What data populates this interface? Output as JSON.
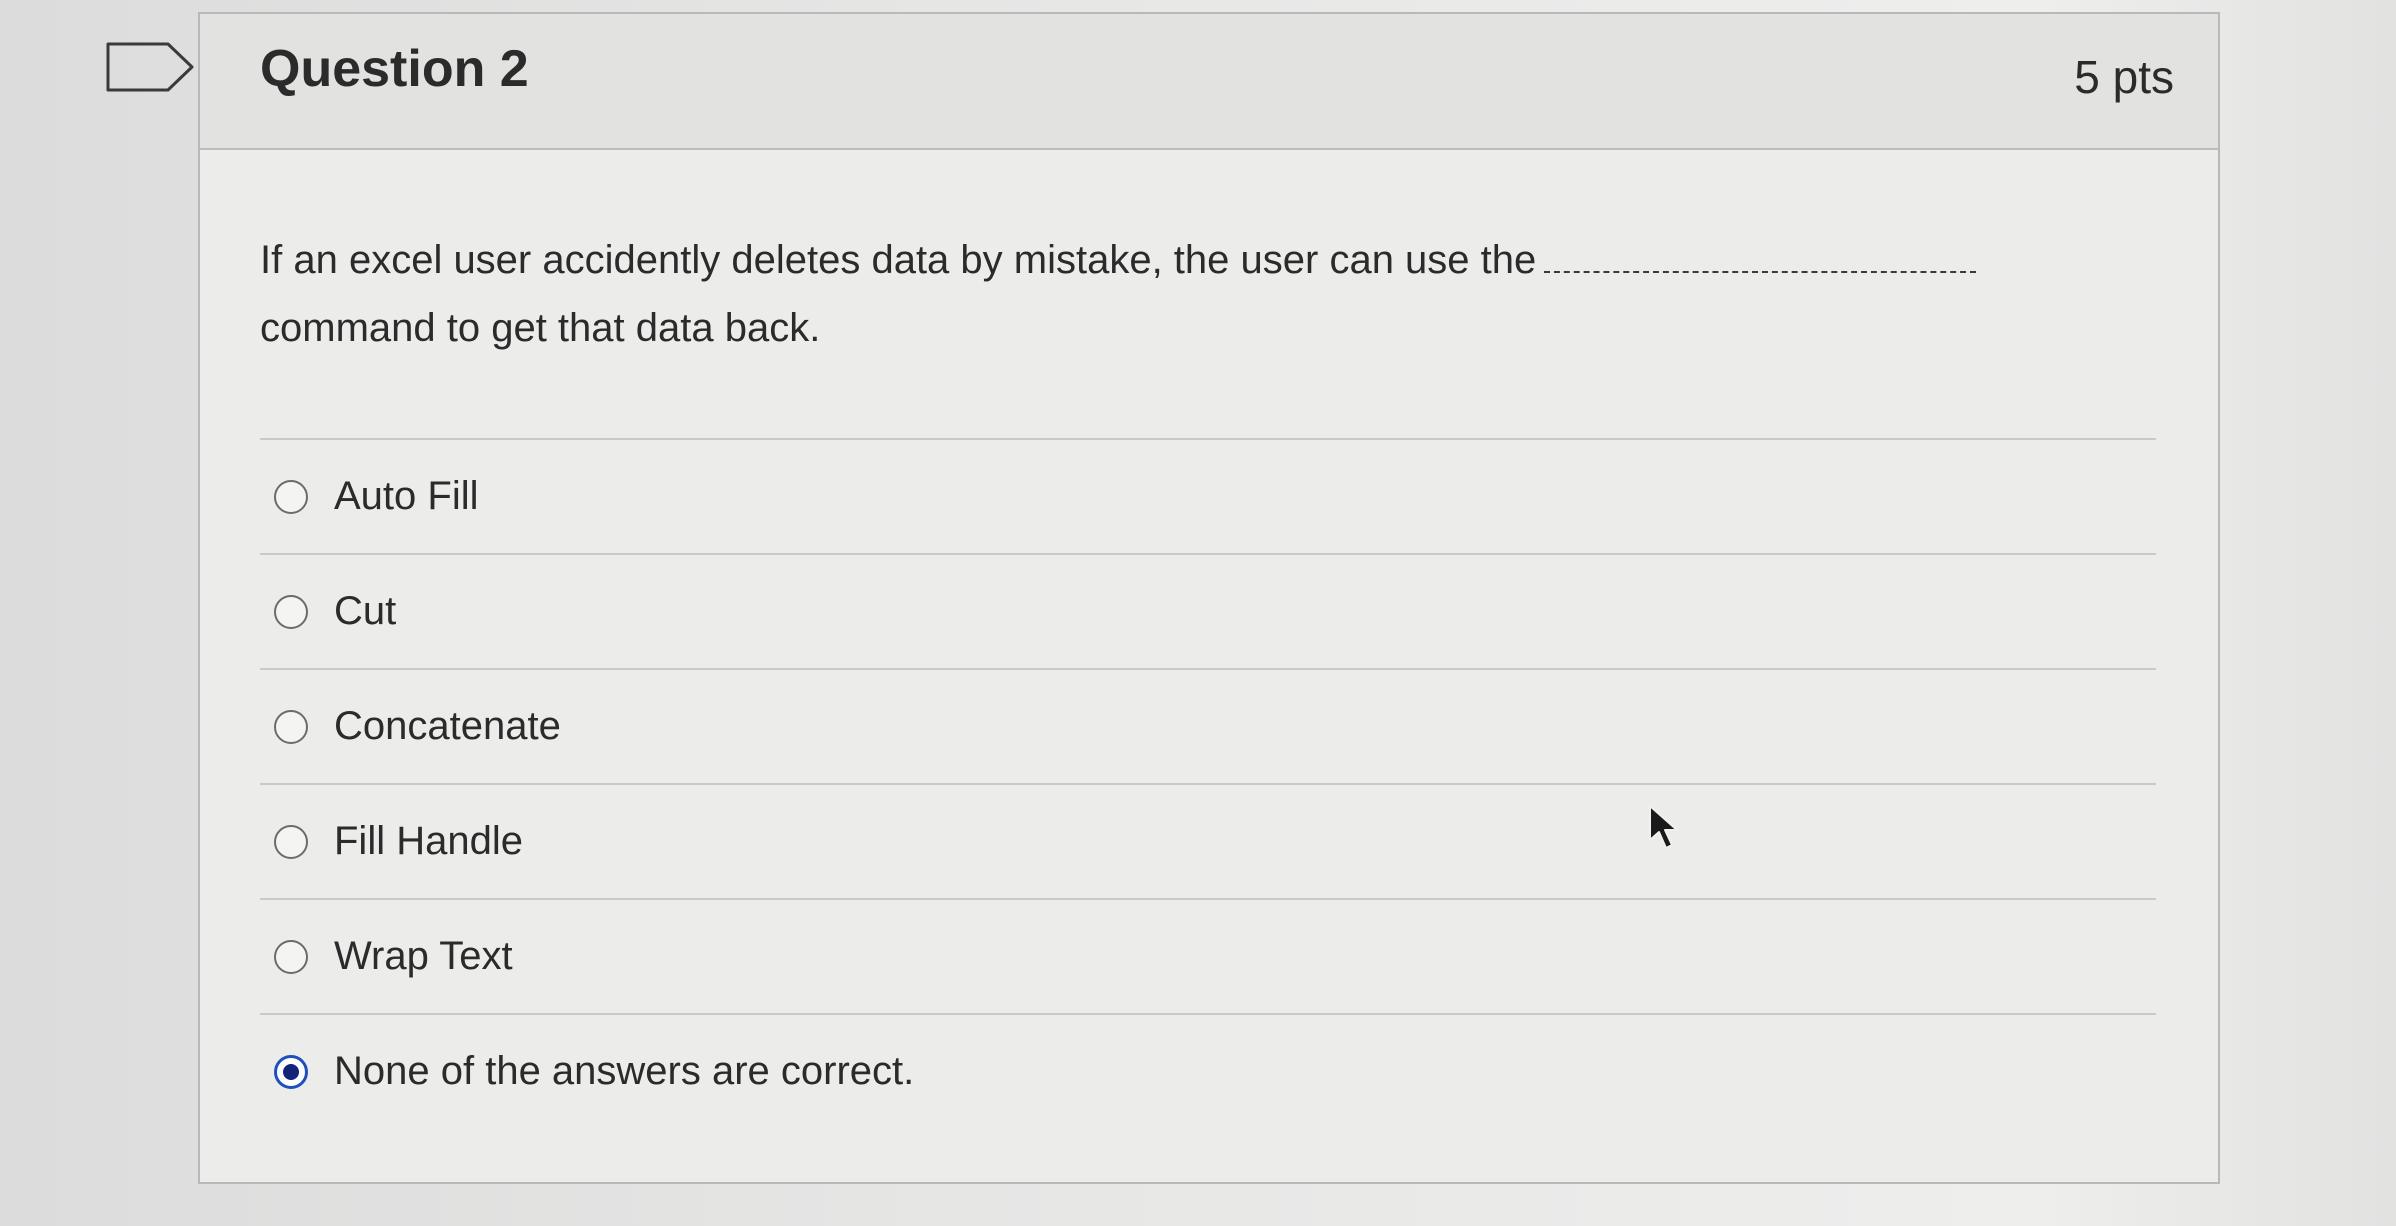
{
  "question": {
    "title": "Question 2",
    "points": "5 pts",
    "text_before_blank": "If an excel user accidently deletes data by mistake, the user can use the",
    "text_after_blank": "command to get that data back.",
    "answers": [
      {
        "label": "Auto Fill",
        "selected": false
      },
      {
        "label": "Cut",
        "selected": false
      },
      {
        "label": "Concatenate",
        "selected": false
      },
      {
        "label": "Fill Handle",
        "selected": false
      },
      {
        "label": "Wrap Text",
        "selected": false
      },
      {
        "label": "None of the answers are correct.",
        "selected": true
      }
    ]
  },
  "icons": {
    "flag": "flag-question-icon",
    "cursor": "mouse-pointer-icon"
  },
  "colors": {
    "radio_selected": "#1f4fbf",
    "radio_dot": "#11247a",
    "text": "#2b2b2b"
  }
}
